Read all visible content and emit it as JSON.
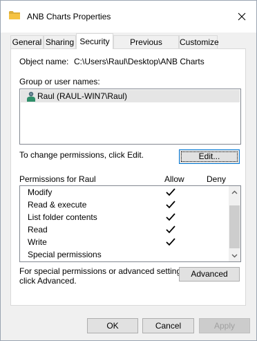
{
  "window": {
    "title": "ANB Charts Properties",
    "close_label": "×"
  },
  "tabs": [
    {
      "label": "General"
    },
    {
      "label": "Sharing"
    },
    {
      "label": "Security"
    },
    {
      "label": "Previous Versions"
    },
    {
      "label": "Customize"
    }
  ],
  "active_tab": "Security",
  "security": {
    "object_name_label": "Object name:",
    "object_name_value": "C:\\Users\\Raul\\Desktop\\ANB Charts",
    "group_label": "Group or user names:",
    "users": [
      {
        "name": "Raul (RAUL-WIN7\\Raul)",
        "selected": true
      }
    ],
    "change_text": "To change permissions, click Edit.",
    "edit_button": "Edit...",
    "permissions_label": "Permissions for Raul",
    "allow_header": "Allow",
    "deny_header": "Deny",
    "permissions": [
      {
        "name": "Modify",
        "allow": true,
        "deny": false
      },
      {
        "name": "Read & execute",
        "allow": true,
        "deny": false
      },
      {
        "name": "List folder contents",
        "allow": true,
        "deny": false
      },
      {
        "name": "Read",
        "allow": true,
        "deny": false
      },
      {
        "name": "Write",
        "allow": true,
        "deny": false
      },
      {
        "name": "Special permissions",
        "allow": false,
        "deny": false
      }
    ],
    "advanced_text_1": "For special permissions or advanced settings,",
    "advanced_text_2": "click Advanced.",
    "advanced_button": "Advanced"
  },
  "footer": {
    "ok": "OK",
    "cancel": "Cancel",
    "apply": "Apply"
  },
  "colors": {
    "focus_border": "#0078d7",
    "folder_yellow": "#f5c242"
  }
}
